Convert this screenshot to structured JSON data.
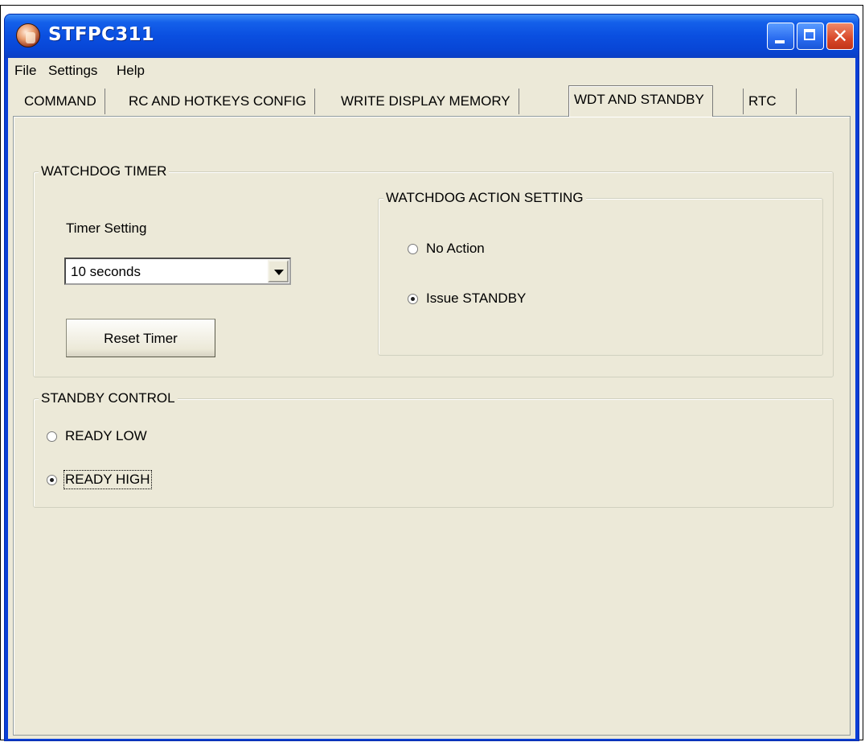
{
  "window": {
    "title": "STFPC311"
  },
  "menu": [
    "File",
    "Settings",
    "Help"
  ],
  "tabs": [
    "COMMAND",
    "RC AND HOTKEYS CONFIG",
    "WRITE DISPLAY MEMORY",
    "WDT AND STANDBY",
    "RTC"
  ],
  "active_tab": "WDT AND STANDBY",
  "watchdog": {
    "group_label": "WATCHDOG TIMER",
    "timer_setting_label": "Timer Setting",
    "timer_value": "10 seconds",
    "reset_button": "Reset Timer",
    "action": {
      "group_label": "WATCHDOG ACTION SETTING",
      "options": [
        "No Action",
        "Issue STANDBY"
      ],
      "selected": "Issue STANDBY"
    }
  },
  "standby": {
    "group_label": "STANDBY CONTROL",
    "options": [
      "READY LOW",
      "READY HIGH"
    ],
    "selected": "READY HIGH"
  },
  "colors": {
    "titlebar": "#0a4fe0",
    "face": "#ece9d8",
    "close": "#d8482a"
  },
  "icons": {
    "app": "app-icon",
    "minimize": "minimize-icon",
    "maximize": "maximize-icon",
    "close": "close-icon",
    "dropdown": "chevron-down-icon"
  }
}
